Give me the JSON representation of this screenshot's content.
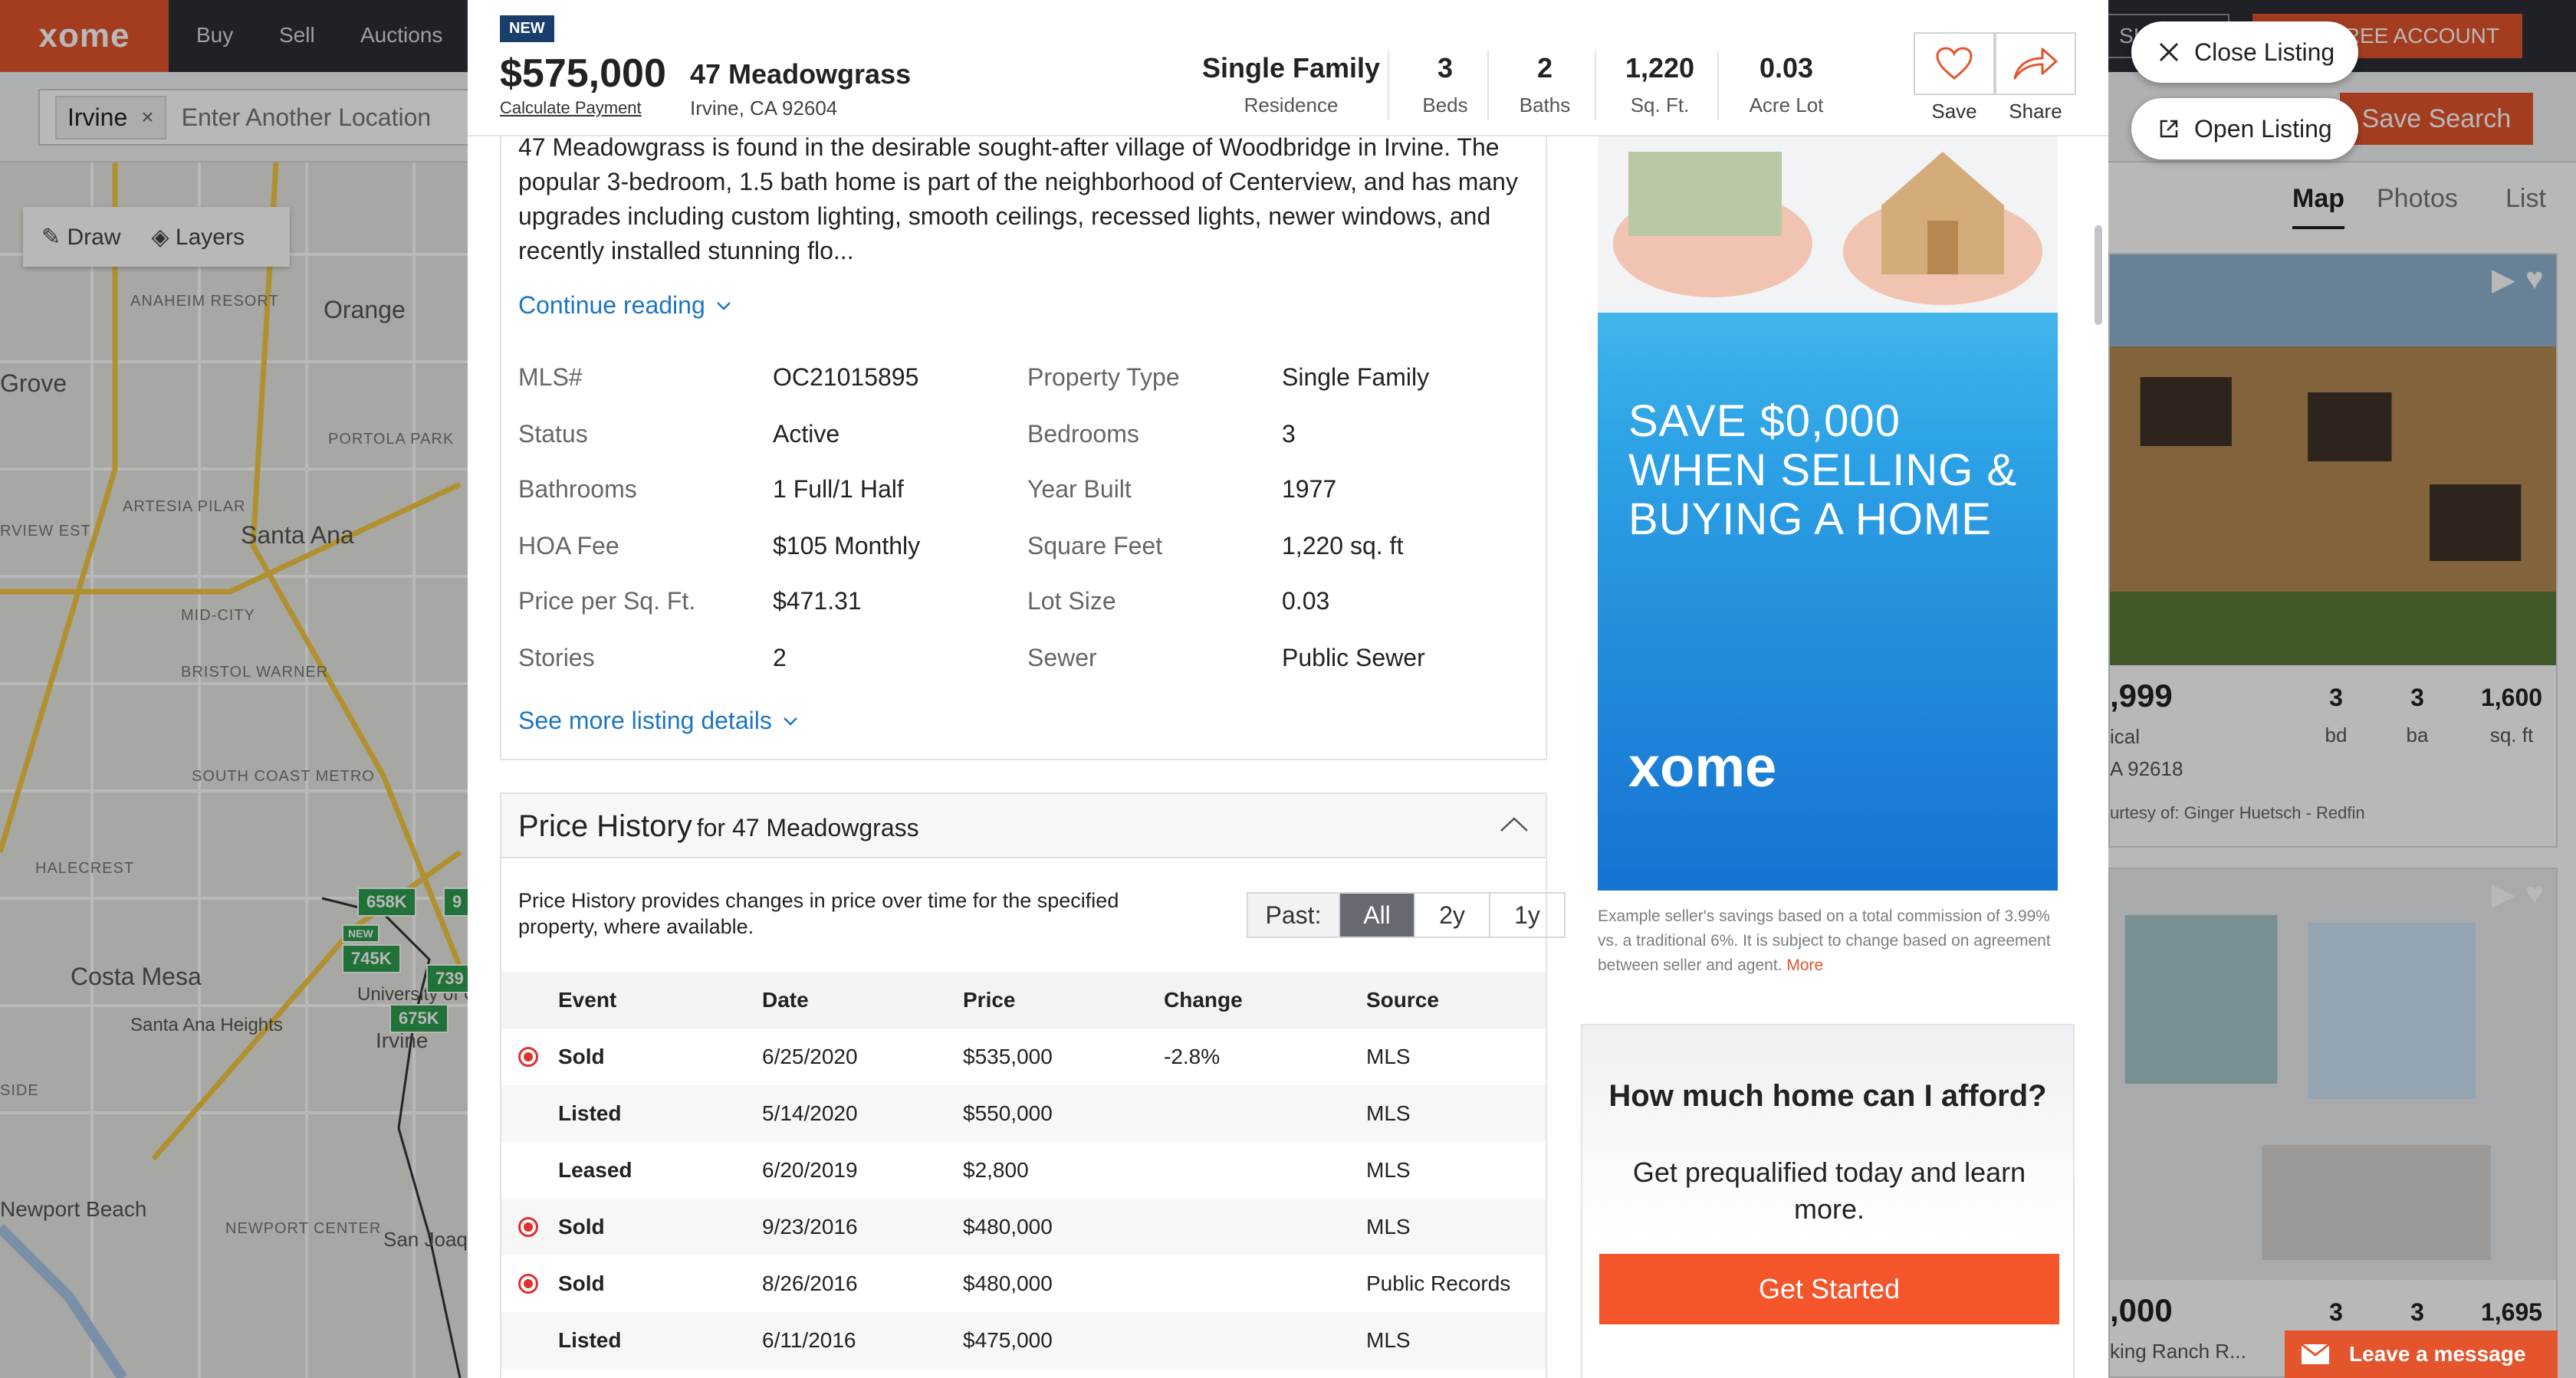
{
  "site": {
    "logo": "xome",
    "nav": [
      "Buy",
      "Sell",
      "Auctions"
    ],
    "sign_in": "SI",
    "create_account": "E FREE ACCOUNT",
    "save_search": "Save Search"
  },
  "search": {
    "chip": "Irvine",
    "chip_close": "×",
    "placeholder": "Enter Another Location"
  },
  "map": {
    "tools": {
      "draw": "Draw",
      "layers": "Layers"
    },
    "labels": [
      "Orange",
      "Grove",
      "Santa Ana",
      "Costa Mesa",
      "Santa Ana Heights",
      "University of Ca",
      "Irvine",
      "Newport Beach",
      "San Joaq Hills"
    ],
    "small_labels": [
      "ANAHEIM RESORT",
      "PORTOLA PARK",
      "ARTESIA PILAR",
      "MID-CITY",
      "BRISTOL WARNER",
      "SOUTH COAST METRO",
      "HALECREST",
      "NEWPORT CENTER",
      "SIDE",
      "RVIEW EST"
    ],
    "pins": [
      "658K",
      "745K",
      "675K",
      "739",
      "9",
      "NEW"
    ],
    "view_tabs": [
      "Map",
      "Photos",
      "List"
    ]
  },
  "cards": [
    {
      "price": ",999",
      "beds": "3",
      "baths": "3",
      "sqft": "1,600",
      "beds_unit": "bd",
      "baths_unit": "ba",
      "sqft_unit": "sq. ft",
      "type": "ical",
      "zip": "A 92618",
      "courtesy": "urtesy of: Ginger Huetsch - Redfin"
    },
    {
      "price": ",000",
      "beds": "3",
      "baths": "3",
      "sqft": "1,695",
      "street": "king Ranch R..."
    }
  ],
  "leave_message": "Leave a message",
  "listing": {
    "badge": "NEW",
    "price": "$575,000",
    "calc_payment": "Calculate Payment",
    "address": "47 Meadowgrass",
    "city_state": "Irvine, CA 92604",
    "stats": [
      {
        "value": "Single Family",
        "label": "Residence"
      },
      {
        "value": "3",
        "label": "Beds"
      },
      {
        "value": "2",
        "label": "Baths"
      },
      {
        "value": "1,220",
        "label": "Sq. Ft."
      },
      {
        "value": "0.03",
        "label": "Acre Lot"
      }
    ],
    "save_label": "Save",
    "share_label": "Share",
    "description": "47 Meadowgrass is found in the desirable sought-after village of Woodbridge in Irvine. The popular 3-bedroom, 1.5 bath home is part of the neighborhood of Centerview, and has many upgrades including custom lighting, smooth ceilings, recessed lights, newer windows, and recently installed stunning flo...",
    "continue_reading": "Continue reading",
    "details": [
      {
        "label": "MLS#",
        "value": "OC21015895"
      },
      {
        "label": "Property Type",
        "value": "Single Family"
      },
      {
        "label": "Status",
        "value": "Active"
      },
      {
        "label": "Bedrooms",
        "value": "3"
      },
      {
        "label": "Bathrooms",
        "value": "1 Full/1 Half"
      },
      {
        "label": "Year Built",
        "value": "1977"
      },
      {
        "label": "HOA Fee",
        "value": "$105 Monthly"
      },
      {
        "label": "Square Feet",
        "value": "1,220 sq. ft"
      },
      {
        "label": "Price per Sq. Ft.",
        "value": "$471.31"
      },
      {
        "label": "Lot Size",
        "value": "0.03"
      },
      {
        "label": "Stories",
        "value": "2"
      },
      {
        "label": "Sewer",
        "value": "Public Sewer"
      }
    ],
    "see_more": "See more listing details"
  },
  "price_history": {
    "title": "Price History",
    "for": "for 47 Meadowgrass",
    "description": "Price History provides changes in price over time for the specified property, where available.",
    "past_label": "Past:",
    "past_options": [
      "All",
      "2y",
      "1y"
    ],
    "past_selected": "All",
    "columns": [
      "Event",
      "Date",
      "Price",
      "Change",
      "Source"
    ],
    "rows": [
      {
        "event": "Sold",
        "date": "6/25/2020",
        "price": "$535,000",
        "change": "-2.8%",
        "source": "MLS",
        "sold": true
      },
      {
        "event": "Listed",
        "date": "5/14/2020",
        "price": "$550,000",
        "change": "",
        "source": "MLS",
        "sold": false
      },
      {
        "event": "Leased",
        "date": "6/20/2019",
        "price": "$2,800",
        "change": "",
        "source": "MLS",
        "sold": false
      },
      {
        "event": "Sold",
        "date": "9/23/2016",
        "price": "$480,000",
        "change": "",
        "source": "MLS",
        "sold": true
      },
      {
        "event": "Sold",
        "date": "8/26/2016",
        "price": "$480,000",
        "change": "",
        "source": "Public Records",
        "sold": true
      },
      {
        "event": "Listed",
        "date": "6/11/2016",
        "price": "$475,000",
        "change": "",
        "source": "MLS",
        "sold": false
      }
    ]
  },
  "ad": {
    "headline": "SAVE $0,000 WHEN SELLING & BUYING A HOME",
    "logo": "xome",
    "footnote": "Example seller's savings based on a total commission of 3.99% vs. a traditional 6%. It is subject to change based on agreement between seller and agent.",
    "more": "More"
  },
  "afford": {
    "title": "How much home can I afford?",
    "body": "Get prequalified today and learn more.",
    "button": "Get Started"
  },
  "float": {
    "close": "Close Listing",
    "open": "Open Listing"
  },
  "colors": {
    "brand": "#e4552d",
    "link": "#1d76c2",
    "sold": "#e03131",
    "pin": "#2e9e4f"
  }
}
